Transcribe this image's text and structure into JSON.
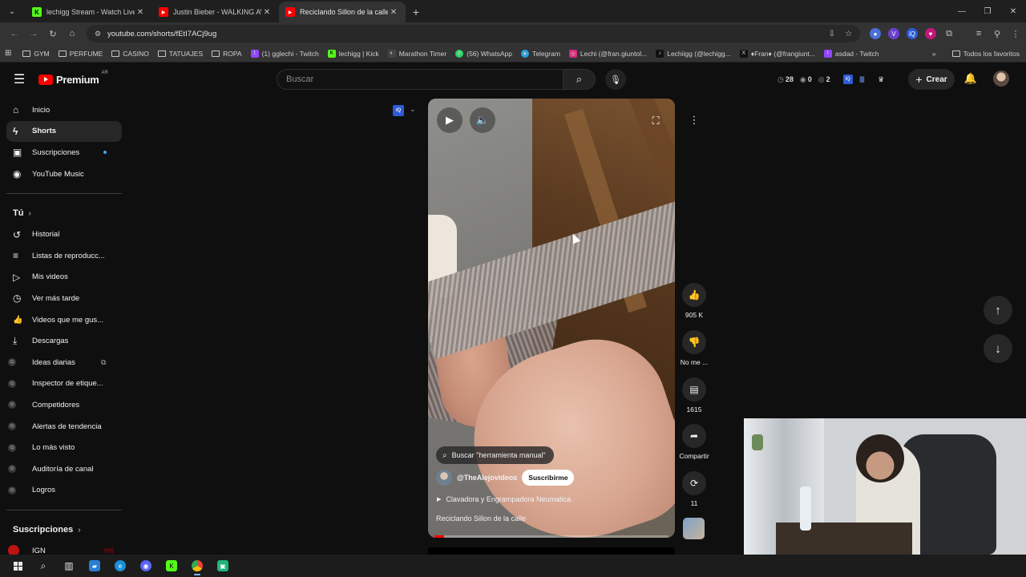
{
  "browser": {
    "tabs": [
      {
        "title": "lechigg Stream - Watch Live on",
        "favicon_color": "#53fc18",
        "favicon_glyph": "K"
      },
      {
        "title": "Justin Bieber - WALKING AWAY",
        "favicon_color": "#ff0000",
        "favicon_glyph": "▶"
      },
      {
        "title": "Reciclando Sillon de la calle - Y",
        "favicon_color": "#ff0000",
        "favicon_glyph": "▶"
      }
    ],
    "url": "youtube.com/shorts/fEtI7ACj9ug",
    "bookmarks": [
      {
        "label": "GYM",
        "type": "folder"
      },
      {
        "label": "PERFUME",
        "type": "folder"
      },
      {
        "label": "CASINO",
        "type": "folder"
      },
      {
        "label": "TATUAJES",
        "type": "folder"
      },
      {
        "label": "ROPA",
        "type": "folder"
      },
      {
        "label": "(1) gglechi - Twitch",
        "type": "link",
        "color": "#9146ff",
        "glyph": "t"
      },
      {
        "label": "lechigg | Kick",
        "type": "link",
        "color": "#53fc18",
        "glyph": "K"
      },
      {
        "label": "Marathon Timer",
        "type": "link",
        "color": "#444444",
        "glyph": "◐"
      },
      {
        "label": "(56) WhatsApp",
        "type": "link",
        "color": "#25d366",
        "glyph": "✆"
      },
      {
        "label": "Telegram",
        "type": "link",
        "color": "#2aa1da",
        "glyph": "➤"
      },
      {
        "label": "Lechi (@fran.giuntol...",
        "type": "link",
        "color": "#d62976",
        "glyph": "◎"
      },
      {
        "label": "Lechiigg (@lechigg...",
        "type": "link",
        "color": "#111111",
        "glyph": "♪"
      },
      {
        "label": "♦Fran♦ (@frangiunt...",
        "type": "link",
        "color": "#111111",
        "glyph": "X"
      },
      {
        "label": "asdad - Twitch",
        "type": "link",
        "color": "#9146ff",
        "glyph": "t"
      }
    ],
    "all_bookmarks": "Todos los favoritos"
  },
  "header": {
    "logo_text": "Premium",
    "region": "AR",
    "search_placeholder": "Buscar",
    "stats": [
      "28",
      "0",
      "2"
    ],
    "create_label": "Crear"
  },
  "sidebar": {
    "main": [
      {
        "label": "Inicio",
        "icon": "⌂"
      },
      {
        "label": "Shorts",
        "icon": "ϟ",
        "active": true
      },
      {
        "label": "Suscripciones",
        "icon": "▣",
        "dot": true
      },
      {
        "label": "YouTube Music",
        "icon": "◉"
      }
    ],
    "you_heading": "Tú",
    "you_items": [
      {
        "label": "Historial",
        "icon": "↺"
      },
      {
        "label": "Listas de reproducc...",
        "icon": "≡"
      },
      {
        "label": "Mis videos",
        "icon": "▷"
      },
      {
        "label": "Ver más tarde",
        "icon": "◷"
      },
      {
        "label": "Videos que me gus...",
        "icon": "👍"
      },
      {
        "label": "Descargas",
        "icon": "⤓"
      }
    ],
    "tools": [
      {
        "label": "Ideas diarias",
        "external": true
      },
      {
        "label": "Inspector de etique..."
      },
      {
        "label": "Competidores"
      },
      {
        "label": "Alertas de tendencia"
      },
      {
        "label": "Lo más visto"
      },
      {
        "label": "Auditoría de canal"
      },
      {
        "label": "Logros"
      }
    ],
    "subs_heading": "Suscripciones",
    "subs": [
      {
        "label": "IGN"
      }
    ]
  },
  "short": {
    "search_chip": "Buscar \"herramienta manual\"",
    "channel": "@TheAlejovideos",
    "subscribe_label": "Suscribirme",
    "music": "Clavadora y Engrampadora Neumatica.",
    "title": "Reciclando Sillon de la calle",
    "progress": 0.04,
    "likes": "905 K",
    "dislike_label": "No me ...",
    "comments": "1615",
    "share_label": "Compartir",
    "remix_count": "11"
  },
  "colors": {
    "accent_red": "#ff0000",
    "bg": "#0f0f0f",
    "chip": "#272727",
    "link_blue": "#3ea6ff"
  }
}
